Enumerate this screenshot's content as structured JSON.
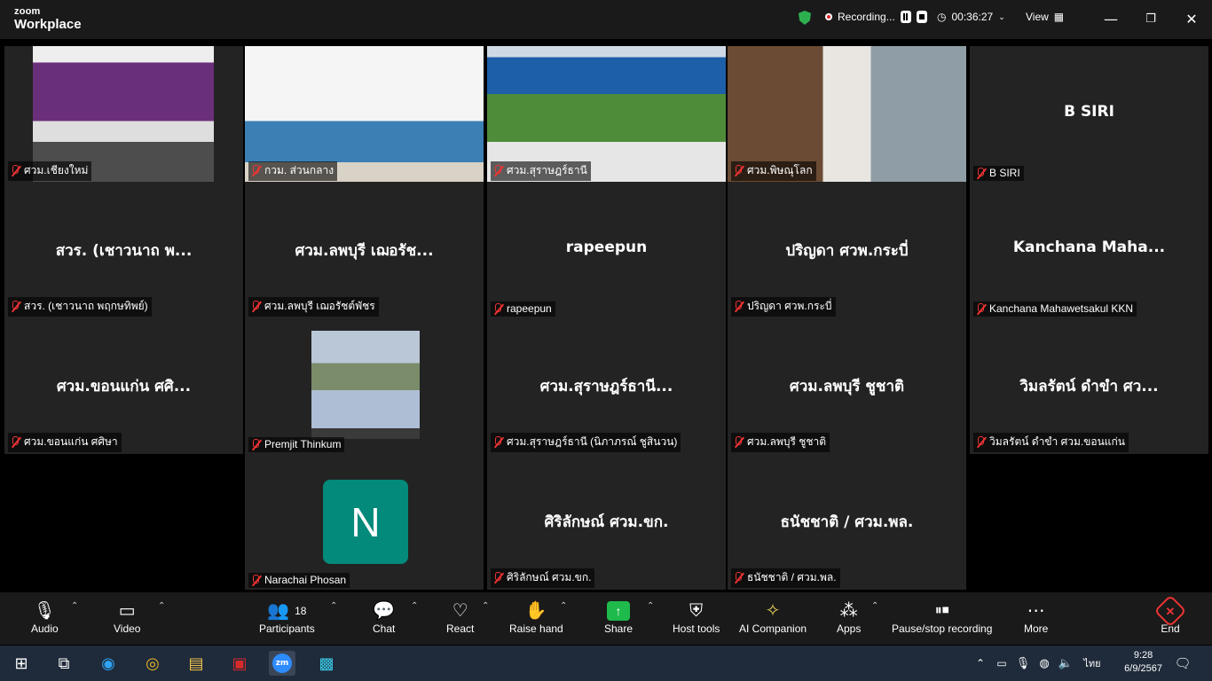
{
  "app": {
    "brand_top": "zoom",
    "brand_bottom": "Workplace"
  },
  "titlebar": {
    "recording": "Recording...",
    "timer": "00:36:27",
    "view": "View"
  },
  "tiles": [
    {
      "big": "",
      "label": "ศวม.เชียงใหม่",
      "video": "a"
    },
    {
      "big": "",
      "label": "กวม. ส่วนกลาง",
      "video": "b"
    },
    {
      "big": "",
      "label": "ศวม.สุราษฎร์ธานี",
      "video": "c"
    },
    {
      "big": "",
      "label": "ศวม.พิษณุโลก",
      "video": "d",
      "active": true
    },
    {
      "big": "B SIRI",
      "label": "B SIRI"
    },
    {
      "big": "สวร. (เชาวนาถ พ...",
      "label": "สวร. (เชาวนาถ พฤกษทิพย์)"
    },
    {
      "big": "ศวม.ลพบุรี เฌอรัช...",
      "label": "ศวม.ลพบุรี เฌอรัชต์พัชร"
    },
    {
      "big": "rapeepun",
      "label": "rapeepun"
    },
    {
      "big": "ปริญดา ศวพ.กระบี่",
      "label": "ปริญดา ศวพ.กระบี่"
    },
    {
      "big": "Kanchana  Maha...",
      "label": "Kanchana Mahawetsakul KKN"
    },
    {
      "big": "ศวม.ขอนแก่น ศศิ...",
      "label": "ศวม.ขอนแก่น ศศิษา"
    },
    {
      "big": "",
      "label": "Premjit Thinkum",
      "photo": true
    },
    {
      "big": "ศวม.สุราษฎร์ธานี...",
      "label": "ศวม.สุราษฎร์ธานี (นิภาภรณ์ ชูสินวน)"
    },
    {
      "big": "ศวม.ลพบุรี ชูชาติ",
      "label": "ศวม.ลพบุรี ชูชาติ"
    },
    {
      "big": "วิมลรัตน์ ดำขำ ศว...",
      "label": "วิมลรัตน์ ดำขำ ศวม.ขอนแก่น"
    },
    {
      "big": "",
      "label": "Narachai Phosan",
      "avatar": "N"
    },
    {
      "big": "ศิริลักษณ์ ศวม.ขก.",
      "label": "ศิริลักษณ์ ศวม.ขก."
    },
    {
      "big": "ธนัชชาติ / ศวม.พล.",
      "label": "ธนัชชาติ / ศวม.พล."
    }
  ],
  "toolbar": {
    "audio": "Audio",
    "video": "Video",
    "participants": "Participants",
    "participants_count": "18",
    "chat": "Chat",
    "react": "React",
    "raise_hand": "Raise hand",
    "share": "Share",
    "host_tools": "Host tools",
    "ai_companion": "AI Companion",
    "apps": "Apps",
    "pause_stop": "Pause/stop recording",
    "more": "More",
    "end": "End"
  },
  "taskbar": {
    "lang": "ไทย",
    "time": "9:28",
    "date": "6/9/2567"
  },
  "colors": {
    "active_border": "#2dc36b",
    "end_red": "#e33333",
    "share_green": "#1eba4b",
    "avatar_teal": "#038a7a"
  }
}
